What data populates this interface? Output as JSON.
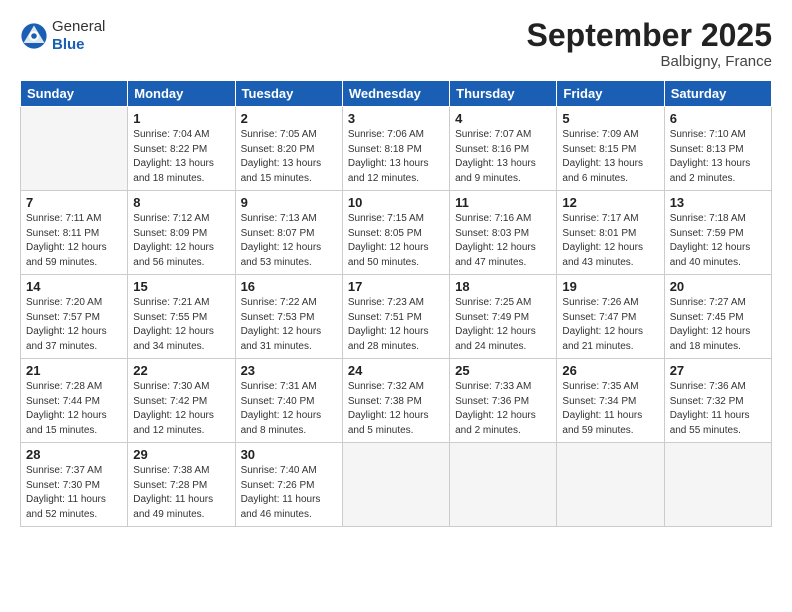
{
  "header": {
    "logo_general": "General",
    "logo_blue": "Blue",
    "title": "September 2025",
    "location": "Balbigny, France"
  },
  "weekdays": [
    "Sunday",
    "Monday",
    "Tuesday",
    "Wednesday",
    "Thursday",
    "Friday",
    "Saturday"
  ],
  "weeks": [
    [
      {
        "day": "",
        "info": ""
      },
      {
        "day": "1",
        "info": "Sunrise: 7:04 AM\nSunset: 8:22 PM\nDaylight: 13 hours\nand 18 minutes."
      },
      {
        "day": "2",
        "info": "Sunrise: 7:05 AM\nSunset: 8:20 PM\nDaylight: 13 hours\nand 15 minutes."
      },
      {
        "day": "3",
        "info": "Sunrise: 7:06 AM\nSunset: 8:18 PM\nDaylight: 13 hours\nand 12 minutes."
      },
      {
        "day": "4",
        "info": "Sunrise: 7:07 AM\nSunset: 8:16 PM\nDaylight: 13 hours\nand 9 minutes."
      },
      {
        "day": "5",
        "info": "Sunrise: 7:09 AM\nSunset: 8:15 PM\nDaylight: 13 hours\nand 6 minutes."
      },
      {
        "day": "6",
        "info": "Sunrise: 7:10 AM\nSunset: 8:13 PM\nDaylight: 13 hours\nand 2 minutes."
      }
    ],
    [
      {
        "day": "7",
        "info": "Sunrise: 7:11 AM\nSunset: 8:11 PM\nDaylight: 12 hours\nand 59 minutes."
      },
      {
        "day": "8",
        "info": "Sunrise: 7:12 AM\nSunset: 8:09 PM\nDaylight: 12 hours\nand 56 minutes."
      },
      {
        "day": "9",
        "info": "Sunrise: 7:13 AM\nSunset: 8:07 PM\nDaylight: 12 hours\nand 53 minutes."
      },
      {
        "day": "10",
        "info": "Sunrise: 7:15 AM\nSunset: 8:05 PM\nDaylight: 12 hours\nand 50 minutes."
      },
      {
        "day": "11",
        "info": "Sunrise: 7:16 AM\nSunset: 8:03 PM\nDaylight: 12 hours\nand 47 minutes."
      },
      {
        "day": "12",
        "info": "Sunrise: 7:17 AM\nSunset: 8:01 PM\nDaylight: 12 hours\nand 43 minutes."
      },
      {
        "day": "13",
        "info": "Sunrise: 7:18 AM\nSunset: 7:59 PM\nDaylight: 12 hours\nand 40 minutes."
      }
    ],
    [
      {
        "day": "14",
        "info": "Sunrise: 7:20 AM\nSunset: 7:57 PM\nDaylight: 12 hours\nand 37 minutes."
      },
      {
        "day": "15",
        "info": "Sunrise: 7:21 AM\nSunset: 7:55 PM\nDaylight: 12 hours\nand 34 minutes."
      },
      {
        "day": "16",
        "info": "Sunrise: 7:22 AM\nSunset: 7:53 PM\nDaylight: 12 hours\nand 31 minutes."
      },
      {
        "day": "17",
        "info": "Sunrise: 7:23 AM\nSunset: 7:51 PM\nDaylight: 12 hours\nand 28 minutes."
      },
      {
        "day": "18",
        "info": "Sunrise: 7:25 AM\nSunset: 7:49 PM\nDaylight: 12 hours\nand 24 minutes."
      },
      {
        "day": "19",
        "info": "Sunrise: 7:26 AM\nSunset: 7:47 PM\nDaylight: 12 hours\nand 21 minutes."
      },
      {
        "day": "20",
        "info": "Sunrise: 7:27 AM\nSunset: 7:45 PM\nDaylight: 12 hours\nand 18 minutes."
      }
    ],
    [
      {
        "day": "21",
        "info": "Sunrise: 7:28 AM\nSunset: 7:44 PM\nDaylight: 12 hours\nand 15 minutes."
      },
      {
        "day": "22",
        "info": "Sunrise: 7:30 AM\nSunset: 7:42 PM\nDaylight: 12 hours\nand 12 minutes."
      },
      {
        "day": "23",
        "info": "Sunrise: 7:31 AM\nSunset: 7:40 PM\nDaylight: 12 hours\nand 8 minutes."
      },
      {
        "day": "24",
        "info": "Sunrise: 7:32 AM\nSunset: 7:38 PM\nDaylight: 12 hours\nand 5 minutes."
      },
      {
        "day": "25",
        "info": "Sunrise: 7:33 AM\nSunset: 7:36 PM\nDaylight: 12 hours\nand 2 minutes."
      },
      {
        "day": "26",
        "info": "Sunrise: 7:35 AM\nSunset: 7:34 PM\nDaylight: 11 hours\nand 59 minutes."
      },
      {
        "day": "27",
        "info": "Sunrise: 7:36 AM\nSunset: 7:32 PM\nDaylight: 11 hours\nand 55 minutes."
      }
    ],
    [
      {
        "day": "28",
        "info": "Sunrise: 7:37 AM\nSunset: 7:30 PM\nDaylight: 11 hours\nand 52 minutes."
      },
      {
        "day": "29",
        "info": "Sunrise: 7:38 AM\nSunset: 7:28 PM\nDaylight: 11 hours\nand 49 minutes."
      },
      {
        "day": "30",
        "info": "Sunrise: 7:40 AM\nSunset: 7:26 PM\nDaylight: 11 hours\nand 46 minutes."
      },
      {
        "day": "",
        "info": ""
      },
      {
        "day": "",
        "info": ""
      },
      {
        "day": "",
        "info": ""
      },
      {
        "day": "",
        "info": ""
      }
    ]
  ]
}
